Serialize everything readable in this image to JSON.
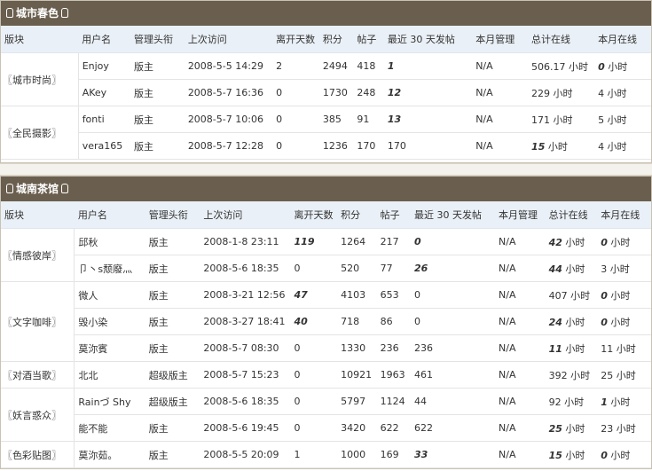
{
  "headers": [
    "版块",
    "用户名",
    "管理头衔",
    "上次访问",
    "离开天数",
    "积分",
    "帖子",
    "最近 30 天发帖",
    "本月管理",
    "总计在线",
    "本月在线"
  ],
  "sections": [
    {
      "title": "城市春色",
      "rows": [
        {
          "board": "〖城市时尚〗",
          "span": 2,
          "user": "Enjoy",
          "role": "版主",
          "last": "2008-5-5 14:29",
          "away": "2",
          "credits": "2494",
          "posts": "418",
          "recent": "1",
          "manage": "N/A",
          "total": "506.17 小时",
          "month": "0 小时"
        },
        {
          "user": "AKey",
          "role": "版主",
          "last": "2008-5-7 16:36",
          "away": "0",
          "credits": "1730",
          "posts": "248",
          "recent": "12",
          "manage": "N/A",
          "total": "229 小时",
          "month": "4 小时"
        },
        {
          "board": "〖全民摄影〗",
          "span": 2,
          "user": "fonti",
          "role": "版主",
          "last": "2008-5-7 10:06",
          "away": "0",
          "credits": "385",
          "posts": "91",
          "recent": "13",
          "manage": "N/A",
          "total": "171 小时",
          "month": "5 小时"
        },
        {
          "user": "vera165",
          "role": "版主",
          "last": "2008-5-7 12:28",
          "away": "0",
          "credits": "1236",
          "posts": "170",
          "recent": "170",
          "manage": "N/A",
          "total": "15 小时",
          "month": "4 小时"
        }
      ]
    },
    {
      "title": "城南茶馆",
      "rows": [
        {
          "board": "〖情感彼岸〗",
          "span": 2,
          "user": "邱秋",
          "role": "版主",
          "last": "2008-1-8 23:11",
          "away": "119",
          "credits": "1264",
          "posts": "217",
          "recent": "0",
          "manage": "N/A",
          "total": "42 小时",
          "month": "0 小时"
        },
        {
          "user": "卩丶s颓廢灬",
          "role": "版主",
          "last": "2008-5-6 18:35",
          "away": "0",
          "credits": "520",
          "posts": "77",
          "recent": "26",
          "manage": "N/A",
          "total": "44 小时",
          "month": "3 小时"
        },
        {
          "board": "〖文字咖啡〗",
          "span": 3,
          "user": "微人",
          "role": "版主",
          "last": "2008-3-21 12:56",
          "away": "47",
          "credits": "4103",
          "posts": "653",
          "recent": "0",
          "manage": "N/A",
          "total": "407 小时",
          "month": "0 小时"
        },
        {
          "user": "毁小染",
          "role": "版主",
          "last": "2008-3-27 18:41",
          "away": "40",
          "credits": "718",
          "posts": "86",
          "recent": "0",
          "manage": "N/A",
          "total": "24 小时",
          "month": "0 小时"
        },
        {
          "user": "莫沵賓",
          "role": "版主",
          "last": "2008-5-7 08:30",
          "away": "0",
          "credits": "1330",
          "posts": "236",
          "recent": "236",
          "manage": "N/A",
          "total": "11 小时",
          "month": "11 小时"
        },
        {
          "board": "〖对酒当歌〗",
          "span": 1,
          "user": "北北",
          "role": "超级版主",
          "last": "2008-5-7 15:23",
          "away": "0",
          "credits": "10921",
          "posts": "1963",
          "recent": "461",
          "manage": "N/A",
          "total": "392 小时",
          "month": "25 小时"
        },
        {
          "board": "〖妖言惑众〗",
          "span": 2,
          "user": "Rainづ Shy",
          "role": "超级版主",
          "last": "2008-5-6 18:35",
          "away": "0",
          "credits": "5797",
          "posts": "1124",
          "recent": "44",
          "manage": "N/A",
          "total": "92 小时",
          "month": "1 小时"
        },
        {
          "user": "能不能",
          "role": "版主",
          "last": "2008-5-6 19:45",
          "away": "0",
          "credits": "3420",
          "posts": "622",
          "recent": "622",
          "manage": "N/A",
          "total": "25 小时",
          "month": "23 小时"
        },
        {
          "board": "〖色彩贴图〗",
          "span": 1,
          "user": "莫沵茹。",
          "role": "版主",
          "last": "2008-5-5 20:09",
          "away": "1",
          "credits": "1000",
          "posts": "169",
          "recent": "33",
          "manage": "N/A",
          "total": "15 小时",
          "month": "0 小时"
        }
      ]
    }
  ]
}
